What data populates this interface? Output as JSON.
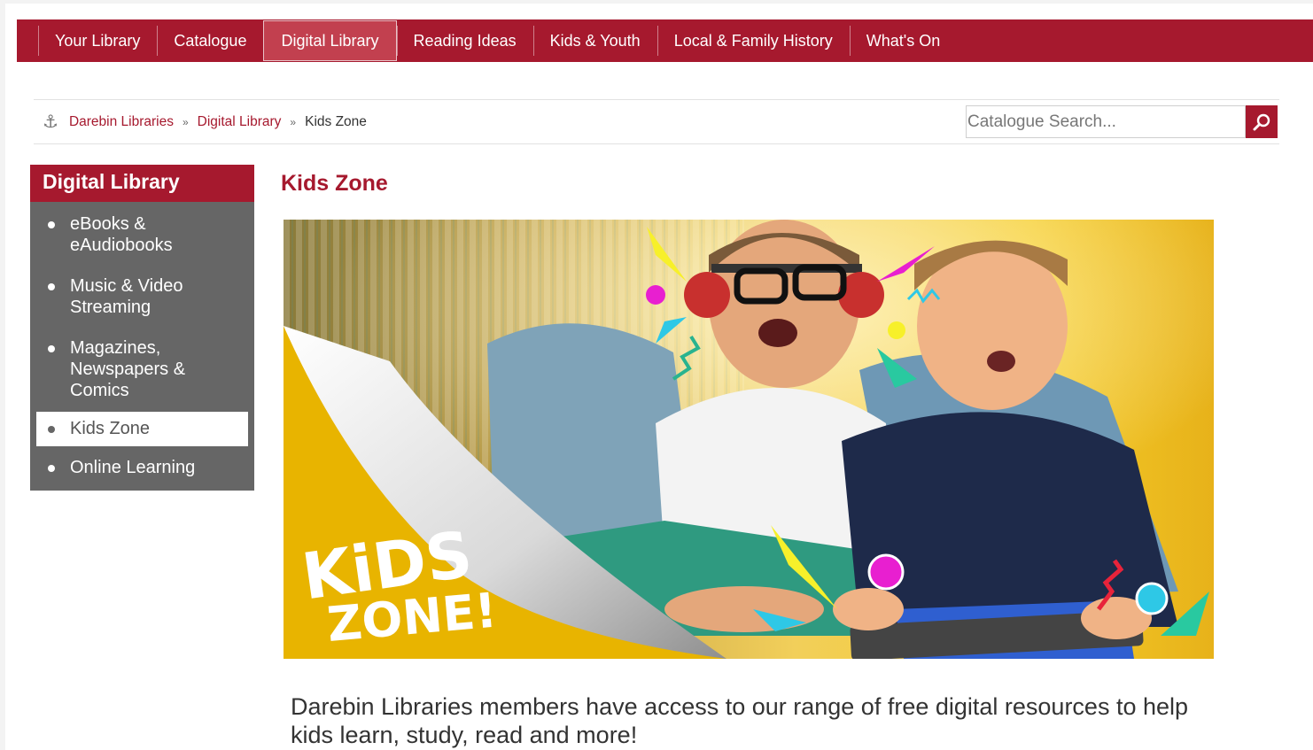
{
  "nav": {
    "items": [
      {
        "label": "Your Library"
      },
      {
        "label": "Catalogue"
      },
      {
        "label": "Digital Library",
        "active": true
      },
      {
        "label": "Reading Ideas"
      },
      {
        "label": "Kids & Youth"
      },
      {
        "label": "Local & Family History"
      },
      {
        "label": "What's On"
      }
    ]
  },
  "breadcrumb": {
    "home": "Darebin Libraries",
    "parent": "Digital Library",
    "current": "Kids Zone"
  },
  "search": {
    "placeholder": "Catalogue Search...",
    "icon": "search-icon"
  },
  "sidebar": {
    "title": "Digital Library",
    "items": [
      {
        "label": "eBooks & eAudiobooks"
      },
      {
        "label": "Music & Video Streaming"
      },
      {
        "label": "Magazines, Newspapers & Comics"
      },
      {
        "label": "Kids Zone",
        "active": true
      },
      {
        "label": "Online Learning"
      }
    ]
  },
  "main": {
    "title": "Kids Zone",
    "hero_logo_text": "KiDS ZONE!",
    "intro": "Darebin Libraries members have access to our range of free digital resources to help kids learn, study, read and more!"
  },
  "colors": {
    "brand": "#a6192e",
    "sidebar_bg": "#666666",
    "hero_yellow": "#e8b400"
  }
}
